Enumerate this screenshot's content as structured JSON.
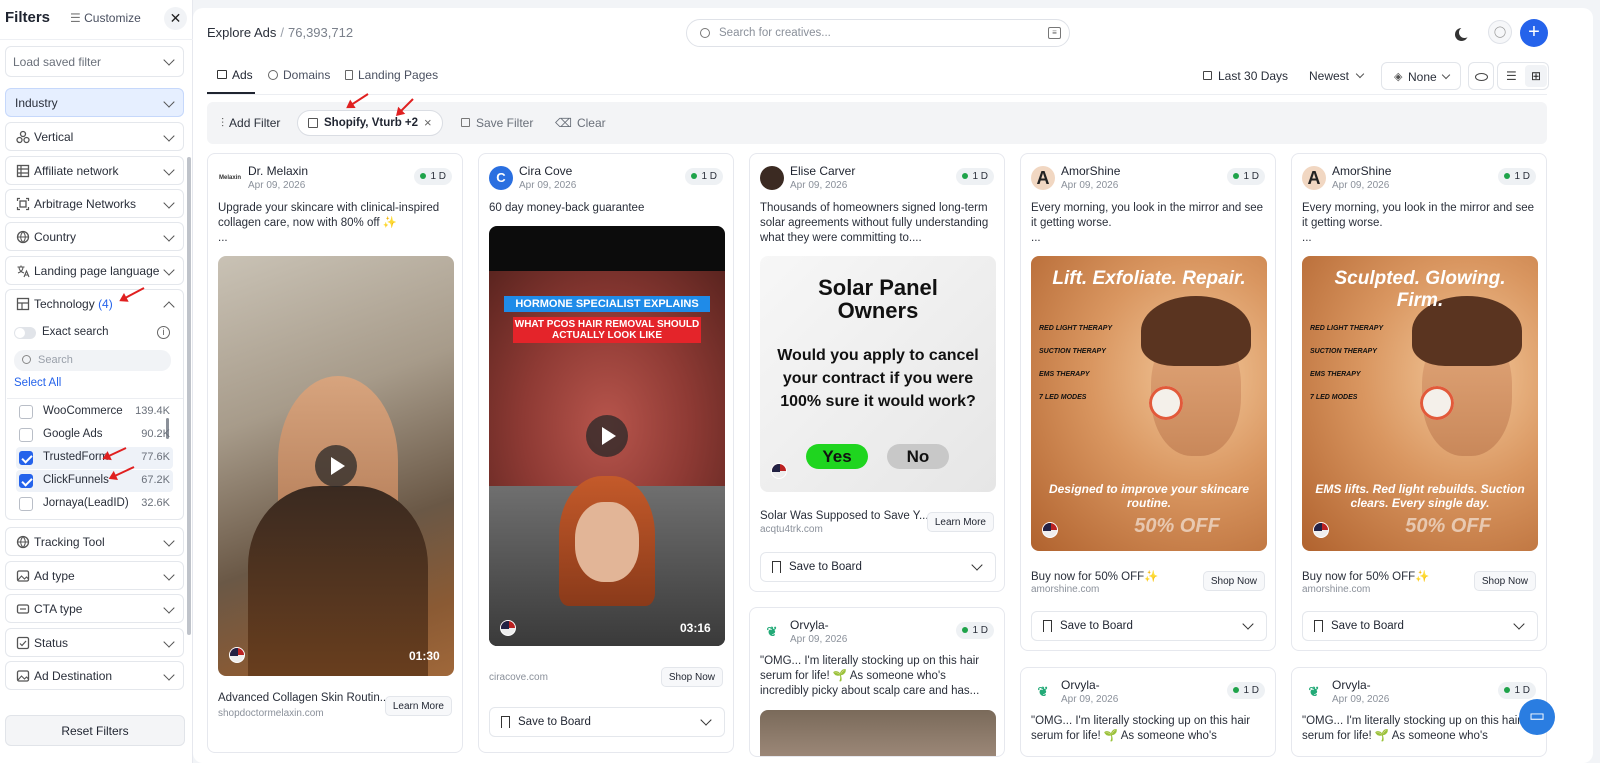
{
  "sidebar": {
    "title": "Filters",
    "customize": "Customize",
    "saved_filter": "Load saved filter",
    "filters": [
      {
        "label": "Industry",
        "icon": "none",
        "selected": true
      },
      {
        "label": "Vertical",
        "icon": "vertical-icon"
      },
      {
        "label": "Affiliate network",
        "icon": "affiliate-icon"
      },
      {
        "label": "Arbitrage Networks",
        "icon": "arbitrage-icon"
      },
      {
        "label": "Country",
        "icon": "globe-icon"
      },
      {
        "label": "Landing page language",
        "icon": "language-icon"
      }
    ],
    "technology": {
      "label": "Technology",
      "count": "(4)",
      "exact_search": "Exact search",
      "search_placeholder": "Search",
      "select_all": "Select All",
      "items": [
        {
          "name": "WooCommerce",
          "count": "139.4K",
          "checked": false
        },
        {
          "name": "Google Ads",
          "count": "90.2K",
          "checked": false
        },
        {
          "name": "TrustedForm",
          "count": "77.6K",
          "checked": true
        },
        {
          "name": "ClickFunnels",
          "count": "67.2K",
          "checked": true
        },
        {
          "name": "Jornaya(LeadID)",
          "count": "32.6K",
          "checked": false
        }
      ]
    },
    "filters_after": [
      {
        "label": "Tracking Tool",
        "icon": "globe-icon"
      },
      {
        "label": "Ad type",
        "icon": "image-icon"
      },
      {
        "label": "CTA type",
        "icon": "cta-icon"
      },
      {
        "label": "Status",
        "icon": "status-icon"
      },
      {
        "label": "Ad Destination",
        "icon": "image-icon"
      }
    ],
    "reset": "Reset Filters"
  },
  "header": {
    "section": "Explore Ads",
    "count": "76,393,712",
    "search_placeholder": "Search for creatives..."
  },
  "tabs": [
    {
      "label": "Ads"
    },
    {
      "label": "Domains"
    },
    {
      "label": "Landing Pages"
    }
  ],
  "controls": {
    "date_range": "Last 30 Days",
    "sort": "Newest",
    "group": "None"
  },
  "filter_bar": {
    "add": "Add Filter",
    "chip": "Shopify, Vturb +2",
    "save": "Save Filter",
    "clear": "Clear"
  },
  "cards": [
    {
      "name": "Dr. Melaxin",
      "date": "Apr 09, 2026",
      "badge": "1 D",
      "text": "Upgrade your skincare with clinical-inspired collagen care, now with 80% off ✨",
      "more": "...",
      "duration": "01:30",
      "title": "Advanced Collagen Skin Routin...",
      "domain": "shopdoctormelaxin.com",
      "cta": "Learn More"
    },
    {
      "name": "Cira Cove",
      "date": "Apr 09, 2026",
      "badge": "1 D",
      "avatar": "C",
      "text": "60 day money-back guarantee",
      "overlay1": "HORMONE SPECIALIST EXPLAINS",
      "overlay2": "WHAT PCOS HAIR REMOVAL SHOULD ACTUALLY LOOK LIKE",
      "duration": "03:16",
      "domain": "ciracove.com",
      "cta": "Shop Now",
      "board": "Save to Board"
    },
    {
      "name": "Elise Carver",
      "date": "Apr 09, 2026",
      "badge": "1 D",
      "text": "Thousands of homeowners signed long-term solar agreements without fully understanding what they were committing to....",
      "img_title": "Solar Panel Owners",
      "img_q": "Would you apply to cancel your contract if you were 100% sure it would work?",
      "yes": "Yes",
      "no": "No",
      "title": "Solar Was Supposed to Save Y...",
      "domain": "acqtu4trk.com",
      "cta": "Learn More",
      "board": "Save to Board"
    },
    {
      "name": "AmorShine",
      "date": "Apr 09, 2026",
      "badge": "1 D",
      "avatar": "A",
      "text": "Every morning, you look in the mirror and see it getting worse.",
      "more": "...",
      "headline": "Lift. Exfoliate. Repair.",
      "features": [
        "RED LIGHT THERAPY",
        "SUCTION THERAPY",
        "EMS THERAPY",
        "7 LED MODES"
      ],
      "tagline": "Designed to improve your skincare routine.",
      "off": "50% OFF",
      "title": "Buy now for 50% OFF✨",
      "domain": "amorshine.com",
      "cta": "Shop Now",
      "board": "Save to Board"
    },
    {
      "name": "AmorShine",
      "date": "Apr 09, 2026",
      "badge": "1 D",
      "avatar": "A",
      "text": "Every morning, you look in the mirror and see it getting worse.",
      "more": "...",
      "headline": "Sculpted. Glowing. Firm.",
      "features": [
        "RED LIGHT THERAPY",
        "SUCTION THERAPY",
        "EMS THERAPY",
        "7 LED MODES"
      ],
      "tagline": "EMS lifts. Red light rebuilds. Suction clears. Every single day.",
      "off": "50% OFF",
      "title": "Buy now for 50% OFF✨",
      "domain": "amorshine.com",
      "cta": "Shop Now",
      "board": "Save to Board"
    },
    {
      "name": "Orvyla-",
      "date": "Apr 09, 2026",
      "badge": "1 D",
      "text": "\"OMG... I'm literally stocking up on this hair serum for life! 🌱 As someone who's incredibly picky about scalp care and has..."
    },
    {
      "name": "Orvyla-",
      "date": "Apr 09, 2026",
      "badge": "1 D",
      "text": "\"OMG... I'm literally stocking up on this hair serum for life! 🌱 As someone who's"
    },
    {
      "name": "Orvyla-",
      "date": "Apr 09, 2026",
      "badge": "1 D",
      "text": "\"OMG... I'm literally stocking up on this hair serum for life! 🌱 As someone who's"
    }
  ]
}
